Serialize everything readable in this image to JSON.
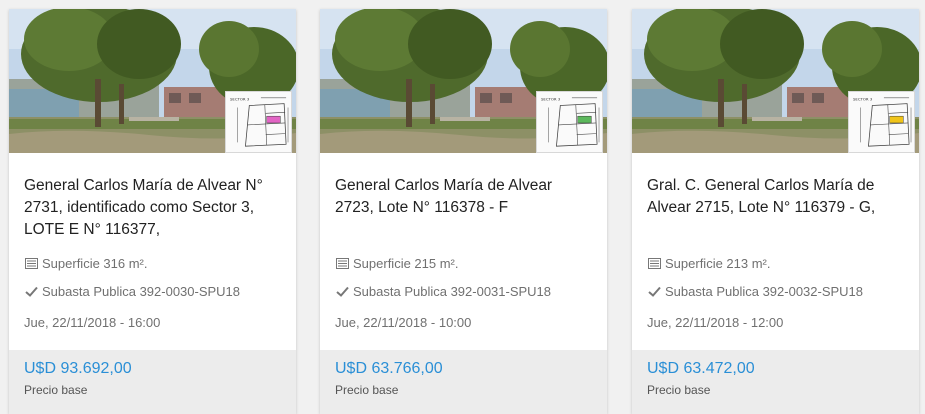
{
  "cards": [
    {
      "title": "General Carlos María de Alvear N° 2731, identificado como Sector 3, LOTE E N° 116377,",
      "surface": "Superficie 316 m².",
      "auction": "Subasta Publica 392-0030-SPU18",
      "date": "Jue, 22/11/2018 - 16:00",
      "price": "U$D 93.692,00",
      "price_label": "Precio base",
      "lot_color": "#e264c4"
    },
    {
      "title": "General Carlos María de Alvear 2723, Lote N° 116378 - F",
      "surface": "Superficie 215 m².",
      "auction": "Subasta Publica 392-0031-SPU18",
      "date": "Jue, 22/11/2018 - 10:00",
      "price": "U$D 63.766,00",
      "price_label": "Precio base",
      "lot_color": "#5cb85c"
    },
    {
      "title": "Gral. C. General Carlos María de Alvear 2715, Lote N° 116379 - G,",
      "surface": "Superficie 213 m².",
      "auction": "Subasta Publica 392-0032-SPU18",
      "date": "Jue, 22/11/2018 - 12:00",
      "price": "U$D 63.472,00",
      "price_label": "Precio base",
      "lot_color": "#f0c419"
    }
  ],
  "icons": {
    "surface": "listing-icon",
    "auction": "check-icon"
  },
  "colors": {
    "price": "#2a8fd6",
    "footer_bg": "#ececec",
    "text_muted": "#707070"
  }
}
